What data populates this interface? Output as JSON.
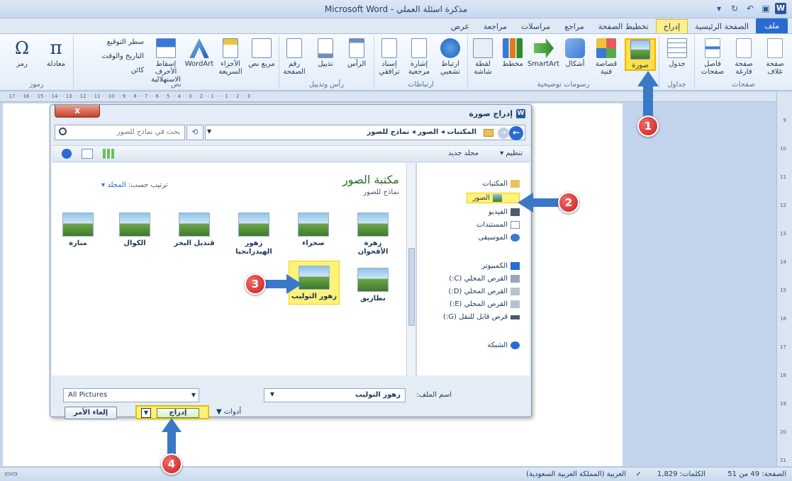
{
  "window": {
    "title": "مذكرة اسئلة العملي - Microsoft Word"
  },
  "tabs": [
    {
      "label": "ملف",
      "type": "file"
    },
    {
      "label": "الصفحة الرئيسية"
    },
    {
      "label": "إدراج",
      "active": true
    },
    {
      "label": "تخطيط الصفحة"
    },
    {
      "label": "مراجع"
    },
    {
      "label": "مراسلات"
    },
    {
      "label": "مراجعة"
    },
    {
      "label": "عرض"
    }
  ],
  "ribbon": {
    "pages_group": {
      "label": "صفحات",
      "buttons": [
        "صفحة غلاف",
        "صفحة فارغة",
        "فاصل صفحات"
      ]
    },
    "tables_group": {
      "label": "جداول",
      "buttons": [
        "جدول"
      ]
    },
    "illustrations_group": {
      "label": "رسومات توضيحية",
      "buttons": [
        "صورة",
        "قصاصة فنية",
        "أشكال",
        "SmartArt",
        "مخطط",
        "لقطة شاشة"
      ]
    },
    "links_group": {
      "label": "ارتباطات",
      "buttons": [
        "ارتباط تشعبي",
        "إشارة مرجعية",
        "إسناد ترافقي"
      ]
    },
    "header_group": {
      "label": "رأس وتذييل",
      "buttons": [
        "الرأس",
        "تذييل",
        "رقم الصفحة"
      ]
    },
    "text_group": {
      "label": "نص",
      "buttons": [
        "مربع نص",
        "الأجزاء السريعة",
        "WordArt",
        "إسقاط الأحرف الاستهلالية"
      ],
      "side": [
        "سطر التوقيع",
        "التاريخ والوقت",
        "كائن"
      ]
    },
    "symbols_group": {
      "label": "رموز",
      "buttons": [
        "معادلة",
        "رمز"
      ]
    }
  },
  "dialog": {
    "title": "إدراج صورة",
    "close": "x",
    "breadcrumb": "المكتبات ◂ الصور ◂ نماذج للصور",
    "search_placeholder": "بحث في نماذج للصور",
    "organize": "تنظيم ▾",
    "new_folder": "مجلد جديد",
    "library_title": "مكتبة الصور",
    "library_subtitle": "نماذج للصور",
    "arrange_label": "ترتيب حسب:",
    "arrange_value": "المجلد ▾",
    "nav": {
      "libraries": "المكتبات",
      "pictures": "الصور",
      "videos": "الفيديو",
      "documents": "المستندات",
      "music": "الموسيقى",
      "computer": "الكمبيوتر",
      "drive_c": "القرص المحلي (C:)",
      "drive_d": "القرص المحلي (D:)",
      "drive_e": "القرص المحلي (E:)",
      "drive_g": "قرص قابل للنقل (G:)",
      "network": "الشبكة"
    },
    "images": [
      {
        "label": "زهرة الأقحوان"
      },
      {
        "label": "صحراء"
      },
      {
        "label": "زهور الهيدرانجيا"
      },
      {
        "label": "قنديل البحر"
      },
      {
        "label": "الكوال"
      },
      {
        "label": "منارة"
      },
      {
        "label": "بطاريق"
      },
      {
        "label": "زهور التوليب",
        "selected": true
      }
    ],
    "filename_label": "اسم الملف:",
    "filename_value": "زهور التوليب",
    "filter": "All Pictures",
    "tools": "أدوات",
    "insert": "إدراج",
    "cancel": "إلغاء الأمر"
  },
  "ruler": {
    "horizontal": "· 17 · · 16 · · 15 · · 14 · · 13 · · 12 · · 11 · · 10 · · 9 · · 8 · · 7 · · 6 · · 5 · · 4 · · 3 · · 2 · · 1 · · · 1 · · 2 · · 3",
    "vertical": [
      "9",
      "10",
      "11",
      "12",
      "13",
      "14",
      "15",
      "16",
      "17",
      "18",
      "19",
      "20",
      "21"
    ]
  },
  "statusbar": {
    "page": "الصفحة: 49 من 51",
    "words": "الكلمات: 1,829",
    "language": "العربية (المملكة العربية السعودية)"
  },
  "callouts": [
    "1",
    "2",
    "3",
    "4"
  ],
  "colors": {
    "highlight": "#fff27a",
    "callout": "#d32f2f",
    "arrow": "#3b78c8"
  }
}
